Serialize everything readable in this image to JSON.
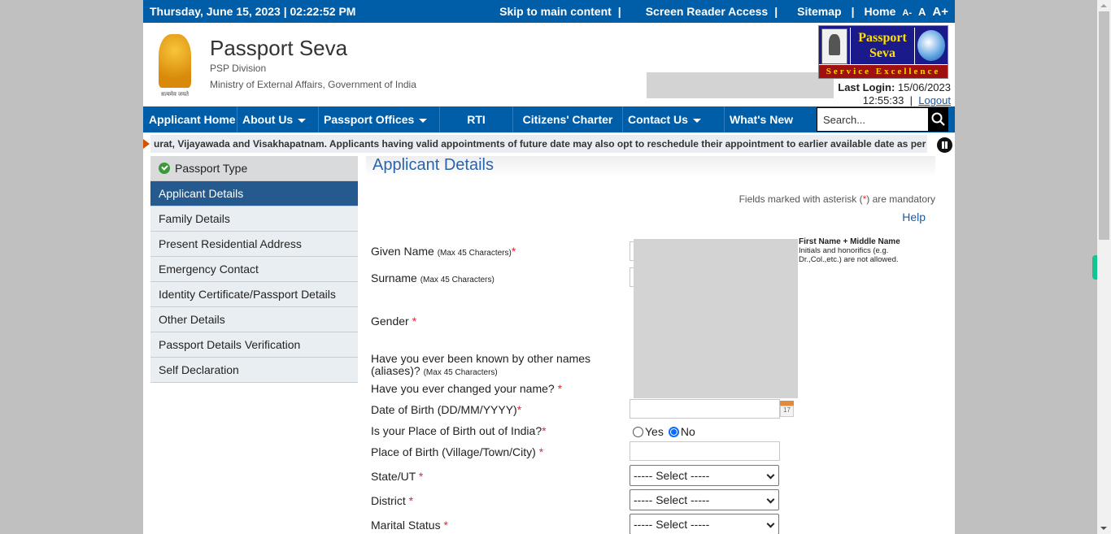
{
  "topbar": {
    "datetime": "Thursday,  June  15, 2023 | 02:22:52 PM",
    "skip_link": "Skip to main content",
    "screen_reader_link": "Screen Reader Access",
    "sitemap_link": "Sitemap",
    "home_link": "Home",
    "separator": "|",
    "font_decrease": "A-",
    "font_normal": "A",
    "font_increase": "A+"
  },
  "header": {
    "title": "Passport Seva",
    "division": "PSP Division",
    "ministry": "Ministry of External Affairs, Government of India",
    "emblem_motto": "सत्यमेव जयते",
    "logo_line1": "Passport",
    "logo_line2": "Seva",
    "logo_band": "Service Excellence",
    "last_login_label": "Last Login:",
    "last_login_date": "15/06/2023",
    "last_login_time": "12:55:33",
    "separator": "|",
    "logout_link": "Logout"
  },
  "nav": {
    "items": [
      {
        "label": "Applicant Home",
        "dropdown": false
      },
      {
        "label": "About Us",
        "dropdown": true
      },
      {
        "label": "Passport Offices",
        "dropdown": true
      },
      {
        "label": "RTI",
        "dropdown": false
      },
      {
        "label": "Citizens' Charter",
        "dropdown": false
      },
      {
        "label": "Contact Us",
        "dropdown": true
      },
      {
        "label": "What's New",
        "dropdown": false
      }
    ],
    "search_placeholder": "Search..."
  },
  "ticker": {
    "text": "urat, Vijayawada and Visakhapatnam. Applicants having valid appointments of future date may also opt to reschedule their appointment to earlier available date as per"
  },
  "sidebar": {
    "items": [
      {
        "label": "Passport Type",
        "state": "completed"
      },
      {
        "label": "Applicant Details",
        "state": "active"
      },
      {
        "label": "Family Details",
        "state": "pending"
      },
      {
        "label": "Present Residential Address",
        "state": "pending"
      },
      {
        "label": "Emergency Contact",
        "state": "pending"
      },
      {
        "label": "Identity Certificate/Passport Details",
        "state": "pending"
      },
      {
        "label": "Other Details",
        "state": "pending"
      },
      {
        "label": "Passport Details Verification",
        "state": "pending"
      },
      {
        "label": "Self Declaration",
        "state": "pending"
      }
    ]
  },
  "main": {
    "title": "Applicant Details",
    "mandatory_note_prefix": "Fields marked with asterisk (",
    "mandatory_note_star": "*",
    "mandatory_note_suffix": ") are mandatory",
    "help_link": "Help",
    "hint_title": "First Name + Middle Name",
    "hint_text": "Initials and honorifics (e.g. Dr.,Col.,etc.) are not allowed.",
    "fields": {
      "given_name": {
        "label": "Given Name",
        "note": "(Max 45 Characters)",
        "required": "*",
        "value": ""
      },
      "surname": {
        "label": "Surname",
        "note": "(Max 45 Characters)",
        "value": ""
      },
      "gender": {
        "label": "Gender",
        "required": "*"
      },
      "aliases": {
        "label_line1": "Have you ever been known by other names",
        "label_line2": "(aliases)?",
        "note": "(Max 45 Characters)"
      },
      "changed_name": {
        "label": "Have you ever changed your name?",
        "required": "*"
      },
      "dob": {
        "label": "Date of Birth (DD/MM/YYYY)",
        "required": "*",
        "value": "",
        "calendar_day": "17"
      },
      "birth_outside": {
        "label": "Is your Place of Birth out of India?",
        "required": "*",
        "options": [
          "Yes",
          "No"
        ],
        "selected": "No"
      },
      "place_of_birth": {
        "label": "Place of Birth (Village/Town/City)",
        "required": "*",
        "value": ""
      },
      "state": {
        "label": "State/UT",
        "required": "*",
        "selected": "----- Select -----"
      },
      "district": {
        "label": "District",
        "required": "*",
        "selected": "----- Select -----"
      },
      "marital_status": {
        "label": "Marital Status",
        "required": "*",
        "selected": "----- Select -----"
      }
    }
  }
}
